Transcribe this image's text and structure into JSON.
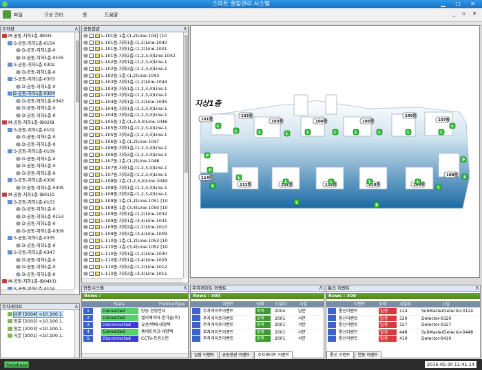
{
  "app": {
    "title": "스마트 출입관리 시스템"
  },
  "menu": {
    "items": [
      "파일",
      "구성 관리",
      "창",
      "도움말"
    ]
  },
  "tree": {
    "title": "주차장",
    "rows": [
      "M-공동-지하1층-(B03)-",
      "S-공동-지하1층-0154",
      "D-공동-지하1층-0",
      "D-공동-지하1층-0155",
      "S-공동-지하1층-0302",
      "D-공동-지하1층-0",
      "S-공동-지하1층-0303",
      "D-공동-지하1층-0",
      "S-공동-지하1층-0304",
      "D-공동-지하1층-0343",
      "D-공동-지하1층-0",
      "D-공동-지하1층-0",
      "M-공동-지하1층-(B02)B",
      "S-공동-지하1층-0102",
      "D-공동-지하1층-0",
      "D-공동-지하1층-0",
      "S-공동-지하1층-0109",
      "D-공동-지하1층-0",
      "D-공동-지하1층-0",
      "D-공동-지하1층-0",
      "S-공동-지하1층-0306",
      "D-공동-지하1층-0345",
      "M-공동-지하1층-(B01)D",
      "S-공동-지하1층-0103",
      "D-공동-지하1층-0",
      "D-공동-지하1층-0153",
      "D-공동-지하1층-0",
      "D-공동-지하1층-0309",
      "S-공동-지하1층-0335",
      "D-공동-지하1층-0",
      "S-공동-지하1층-0347",
      "D-공동-지하1층-0",
      "D-공동-지하1층-0",
      "D-공동-지하1층-0",
      "M-공동-지하1층-(B04)(D",
      "S-공동-지하1층-0104"
    ]
  },
  "gates": {
    "title": "주차게이트",
    "rows": [
      "남문 [2004] <10.100.1.",
      "동문 [2002] <10.100.1.",
      "동문 [2003] <10.100.1.",
      "서문 [2001] <10.100.1."
    ]
  },
  "common": {
    "title": "공동현관",
    "rows": [
      "L-101동-1층-(1,2)Line-104] [10",
      "L-101동-지하1층-(1,2)Line-1040",
      "L-101동-지하1층-(1,2)Line-1001",
      "L-101동-지하2층-(1,2,3,4)Line-1042",
      "L-102동-지하1층-(1,2,3,4)Line-1",
      "L-102동-지하2층-(1,2,3,4)Line-1",
      "L-102동-1층-(1,2)Line-1043",
      "L-103동-지하1층-(1,2)Line-1044",
      "L-103동-지하1층-(1,2,3,4)Line-1",
      "L-103동-지하2층-(1,2,3,4)Line-1",
      "L-104동-지하1층-(1,2)Line-1045",
      "L-104동-지하1층-(1,2,3,4)Line-1",
      "L-104동-지하2층-(1,2,3,4)Line-1",
      "L-105동-1층-(1,2,3,4)Line-1046",
      "L-105동-지하1층-(1,2,3,4)Line-1",
      "L-105동-지하2층-(1,2,3,4)Line-1",
      "L-106동-1층-(1,2)Line-1047",
      "L-106동-지하1층-(1,2,3,4)Line-1",
      "L-106동-지하2층-(1,2,3,4)Line-1",
      "L-107동-1층-(1,2)Line-1048",
      "L-107동-지하1층-(1,2,3,4)Line-1",
      "L-107동-지하2층-(1,2,3,4)Line-1",
      "L-108동-1층-(1,2,3,4)Line-1049",
      "L-108동-지하1층-(1,2,3,4)Line-1",
      "L-108동-지하2층-(1,2,3,4)Line-1",
      "L-109동-1층-(1,2)Line-1051 [10",
      "L-109동-1층-(3,4)Line-1050 [10",
      "L-109동-지하1층-(1,2)Line-1032",
      "L-109동-지하1층-(3,4)Line-1031",
      "L-109동-지하2층-(1,2)Line-1010",
      "L-109동-지하2층-(3,4)Line-1009",
      "L-110동-1층-(1,2)Line-1053 [10",
      "L-110동-1층-(3,4)Line-1052 [10",
      "L-110동-지하1층-(1,2)Line-1030",
      "L-110동-지하1층-(3,4)Line-1029",
      "L-110동-지하2층-(1,2)Line-1012",
      "L-110동-지하2층-(3,4)Line-1011"
    ]
  },
  "map": {
    "floor_label": "지상1층",
    "dong_labels": [
      "101동",
      "102동",
      "103동",
      "104동",
      "105동",
      "106동",
      "107동",
      "114동",
      "113동",
      "112동",
      "111동",
      "110동",
      "109동",
      "108동"
    ],
    "marker_labels": [
      "L",
      "P"
    ]
  },
  "linkage": {
    "title": "연동시스템",
    "rows_label": "Rows :",
    "columns": [
      "State",
      "ProtocolType"
    ],
    "rows": [
      {
        "n": "1",
        "state": "Connected",
        "proto": "방송-한양전자",
        "color": "#5bd06a"
      },
      {
        "n": "2",
        "state": "Connected",
        "proto": "엘리베이터-한기술(미)",
        "color": "#5bd06a"
      },
      {
        "n": "3",
        "state": "Disconnected",
        "proto": "유관/택배-대양택",
        "color": "#3b3bd6"
      },
      {
        "n": "4",
        "state": "Connected",
        "proto": "홈네트워크-대양택",
        "color": "#5bd06a"
      },
      {
        "n": "5",
        "state": "Disconnected",
        "proto": "CCTV-트윈스핀",
        "color": "#3b3bd6"
      }
    ]
  },
  "gate_events": {
    "title": "주차게이트 이벤트",
    "rows_label": "Rows : 300",
    "columns": [
      "이벤트",
      "상태",
      "시설ID",
      "시설"
    ],
    "rows": [
      [
        "주차게이트이벤트",
        "화북",
        "2004",
        "남문"
      ],
      [
        "주차게이트이벤트",
        "화북",
        "2001",
        "서문"
      ],
      [
        "주차게이트이벤트",
        "화북",
        "2001",
        "서문"
      ],
      [
        "주차게이트이벤트",
        "화북",
        "2001",
        "서문"
      ],
      [
        "주차게이트이벤트",
        "화북",
        "2001",
        "서문"
      ]
    ],
    "tabs": [
      "알람 이벤트",
      "공동현관 이벤트",
      "주차게이트 이벤트"
    ]
  },
  "comm_events": {
    "title": "통신 이벤트",
    "rows_label": "Rows : 300",
    "columns": [
      "이벤트",
      "상태",
      "시설ID",
      "시설"
    ],
    "rows": [
      [
        "통신이벤트",
        "발생",
        "124",
        "SubMasterDetector-0124"
      ],
      [
        "통신이벤트",
        "발생",
        "320",
        "Detector-0320"
      ],
      [
        "통신이벤트",
        "발생",
        "327",
        "Detector-0327"
      ],
      [
        "통신이벤트",
        "발생",
        "448",
        "SubMasterDetector-0448"
      ],
      [
        "통신이벤트",
        "발생",
        "410",
        "Detector-0410"
      ]
    ],
    "tabs": [
      "통신 이벤트",
      "연동 이벤트"
    ]
  },
  "status": {
    "db_label": "Database",
    "datetime": "2016-05-30  11:41:14"
  }
}
